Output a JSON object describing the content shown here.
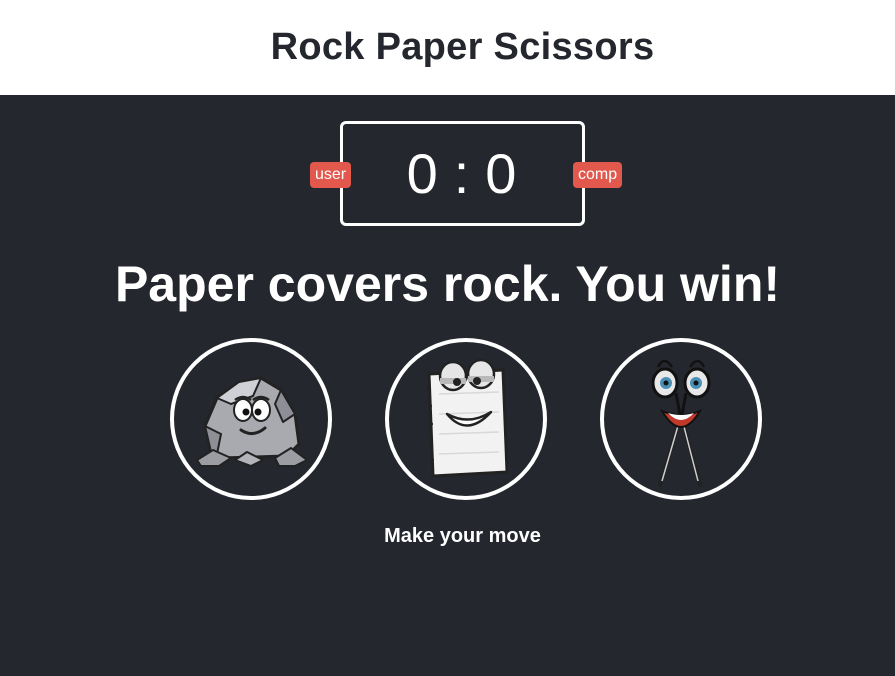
{
  "header": {
    "title": "Rock Paper Scissors"
  },
  "score": {
    "user_label": "user",
    "comp_label": "comp",
    "user_score": "0",
    "separator": ":",
    "comp_score": "0"
  },
  "result": {
    "message": "Paper covers rock. You win!"
  },
  "choices": [
    {
      "id": "rock",
      "icon": "rock-character-icon"
    },
    {
      "id": "paper",
      "icon": "paper-character-icon"
    },
    {
      "id": "scissors",
      "icon": "scissors-character-icon"
    }
  ],
  "action": {
    "message": "Make your move"
  },
  "colors": {
    "background": "#24272e",
    "header_background": "#ffffff",
    "badge": "#e2584d",
    "text": "#ffffff"
  }
}
